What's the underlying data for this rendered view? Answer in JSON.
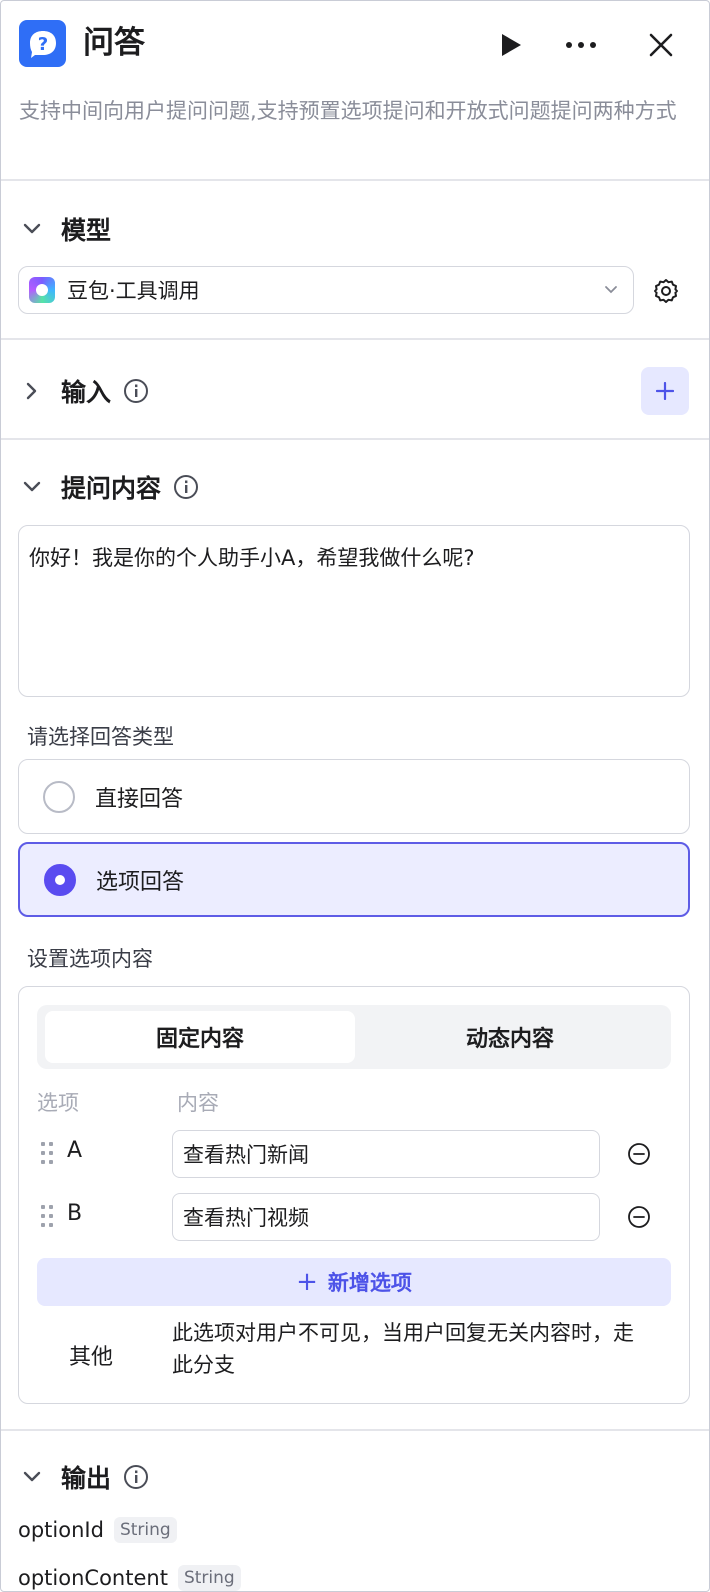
{
  "header": {
    "title": "问答",
    "description": "支持中间向用户提问问题,支持预置选项提问和开放式问题提问两种方式"
  },
  "model": {
    "section_title": "模型",
    "selected": "豆包·工具调用"
  },
  "input": {
    "section_title": "输入"
  },
  "question": {
    "section_title": "提问内容",
    "content": "你好！我是你的个人助手小A，希望我做什么呢?",
    "answer_type_label": "请选择回答类型",
    "answer_types": [
      "直接回答",
      "选项回答"
    ],
    "selected_answer_type": "选项回答",
    "options_label": "设置选项内容",
    "tabs": [
      "固定内容",
      "动态内容"
    ],
    "active_tab": "固定内容",
    "columns": [
      "选项",
      "内容"
    ],
    "options": [
      {
        "letter": "A",
        "content": "查看热门新闻"
      },
      {
        "letter": "B",
        "content": "查看热门视频"
      }
    ],
    "add_option_label": "新增选项",
    "other_label": "其他",
    "other_description": "此选项对用户不可见，当用户回复无关内容时，走此分支"
  },
  "output": {
    "section_title": "输出",
    "fields": [
      {
        "name": "optionId",
        "type": "String"
      },
      {
        "name": "optionContent",
        "type": "String"
      }
    ]
  },
  "colors": {
    "accent": "#5a4cf0",
    "app_icon": "#2f6ef6",
    "selected_bg": "#ecedff"
  }
}
